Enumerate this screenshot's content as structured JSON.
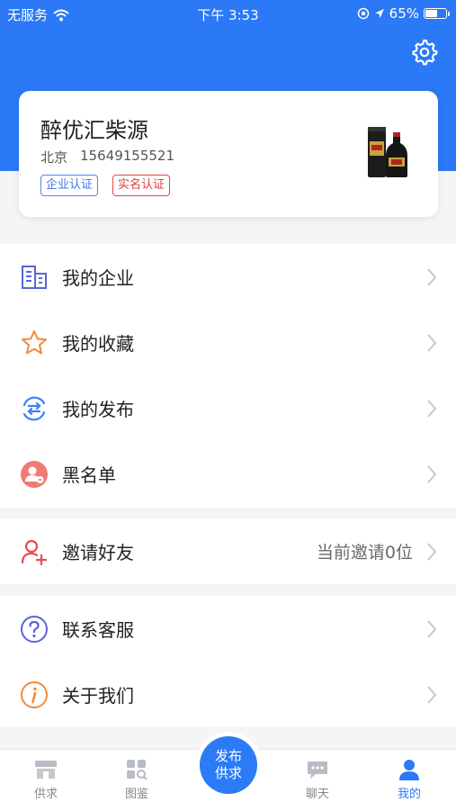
{
  "status_bar": {
    "carrier": "无服务",
    "time": "下午 3:53",
    "battery_percent": "65%",
    "battery_level": 0.65
  },
  "header": {
    "background": "#2b79f6",
    "settings_icon": "gear-icon"
  },
  "profile": {
    "name": "醉优汇柴源",
    "city": "北京",
    "phone": "15649155521",
    "badges": [
      "企业认证",
      "实名认证"
    ]
  },
  "menu": {
    "group1": [
      {
        "label": "我的企业",
        "icon": "building-icon"
      },
      {
        "label": "我的收藏",
        "icon": "star-icon"
      },
      {
        "label": "我的发布",
        "icon": "publish-icon"
      },
      {
        "label": "黑名单",
        "icon": "blacklist-icon"
      }
    ],
    "invite": {
      "label": "邀请好友",
      "value": "当前邀请0位",
      "icon": "add-user-icon"
    },
    "group3": [
      {
        "label": "联系客服",
        "icon": "help-icon"
      },
      {
        "label": "关于我们",
        "icon": "info-icon"
      }
    ]
  },
  "tabbar": {
    "tabs": [
      "供求",
      "图鉴",
      "聊天",
      "我的"
    ],
    "fab_line1": "发布",
    "fab_line2": "供求",
    "active": "我的",
    "accent": "#2b79f6"
  }
}
